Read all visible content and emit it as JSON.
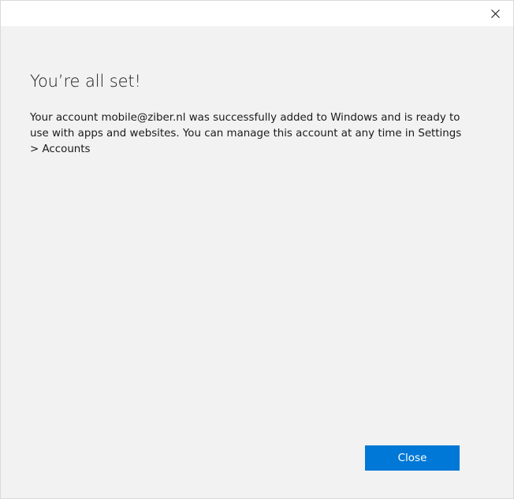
{
  "window": {
    "close_icon": "close-icon"
  },
  "dialog": {
    "heading": "You’re all set!",
    "message": "Your account mobile@ziber.nl was successfully added to Windows and is ready to use with apps and websites. You can manage this account at any time in Settings > Accounts",
    "close_button_label": "Close"
  },
  "colors": {
    "accent": "#0078d7",
    "background": "#f2f2f2",
    "titlebar": "#ffffff",
    "text": "#1a1a1a"
  }
}
